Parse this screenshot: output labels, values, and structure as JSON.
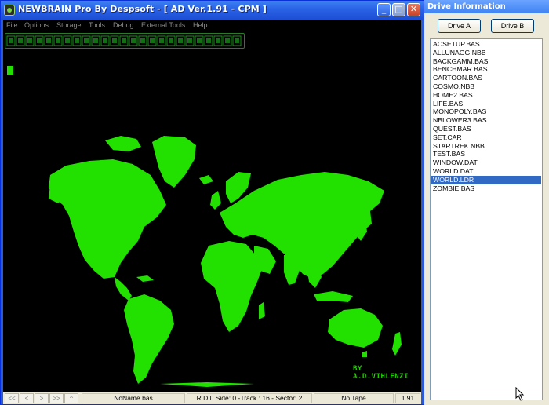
{
  "window": {
    "title": "NEWBRAIN Pro By Despsoft - [ AD Ver.1.91 - CPM ]",
    "controls": {
      "minimize": "_",
      "maximize": "□",
      "close": "✕"
    },
    "icon": "app-icon"
  },
  "menu": [
    "File",
    "Options",
    "Storage",
    "Tools",
    "Debug",
    "External Tools",
    "Help"
  ],
  "screen": {
    "credit_text": "BY A.D.VIHLENZI",
    "phosphor_color": "#22e000",
    "background_color": "#000000"
  },
  "status_bar": {
    "nav": [
      "<<",
      "<",
      ">",
      ">>",
      "^"
    ],
    "filename": "NoName.bas",
    "disk_info": "R D:0 Side: 0 -Track : 16 - Sector: 2",
    "tape": "No Tape",
    "version": "1.91"
  },
  "drive_panel": {
    "title": "Drive Information",
    "drive_a": "Drive A",
    "drive_b": "Drive B",
    "files": [
      "ACSETUP.BAS",
      "ALLUNAGG.NBB",
      "BACKGAMM.BAS",
      "BENCHMAR.BAS",
      "CARTOON.BAS",
      "COSMO.NBB",
      "HOME2.BAS",
      "LIFE.BAS",
      "MONOPOLY.BAS",
      "NBLOWER3.BAS",
      "QUEST.BAS",
      "SET.CAR",
      "STARTREK.NBB",
      "TEST.BAS",
      "WINDOW.DAT",
      "WORLD.DAT",
      "WORLD.LDR",
      "ZOMBIE.BAS"
    ],
    "selected_file": "WORLD.LDR",
    "selection_color": "#316ac5"
  }
}
